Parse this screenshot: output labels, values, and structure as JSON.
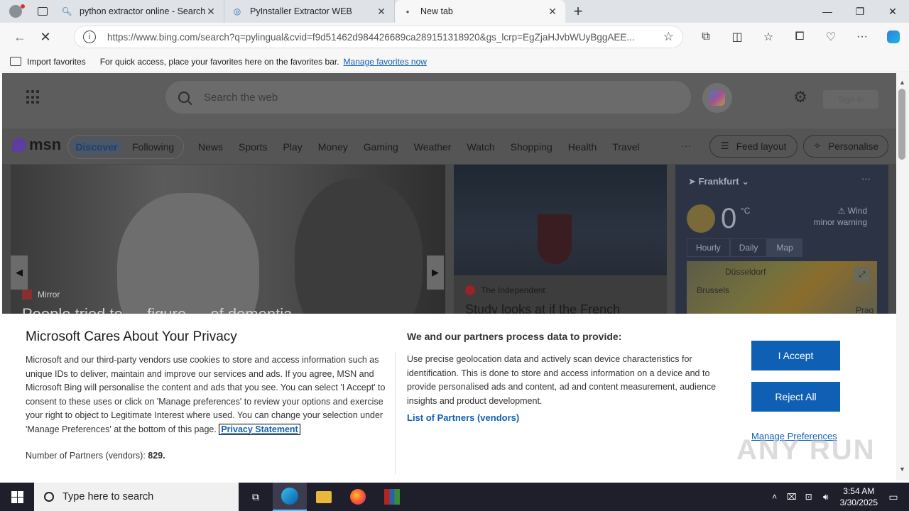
{
  "browser": {
    "tabs": [
      {
        "title": "python extractor online - Search",
        "icon": "search-icon"
      },
      {
        "title": "PyInstaller Extractor WEB",
        "icon": "globe-icon"
      },
      {
        "title": "New tab",
        "icon": "loading-dot-icon"
      }
    ],
    "url": "https://www.bing.com/search?q=pylingual&cvid=f9d51462d984426689ca289151318920&gs_lcrp=EgZjaHJvbWUyBggAEE...",
    "favorites_bar": {
      "import_label": "Import favorites",
      "hint": "For quick access, place your favorites here on the favorites bar.",
      "manage_link": "Manage favorites now"
    }
  },
  "msn": {
    "search_placeholder": "Search the web",
    "signin": "Sign in",
    "logo": "msn",
    "discover": "Discover",
    "following": "Following",
    "categories": [
      "News",
      "Sports",
      "Play",
      "Money",
      "Gaming",
      "Weather",
      "Watch",
      "Shopping",
      "Health",
      "Travel"
    ],
    "more": "···",
    "feed_layout": "Feed layout",
    "personalise": "Personalise",
    "hero": {
      "source": "Mirror",
      "headline": "People tried to … figure … of dementia"
    },
    "card2": {
      "source": "The Independent",
      "title": "Study looks at if the French"
    },
    "weather": {
      "location": "Frankfurt",
      "temp": "0",
      "unit": "°C",
      "warning_title": "Wind",
      "warning_sub": "minor warning",
      "tabs": [
        "Hourly",
        "Daily",
        "Map"
      ],
      "selected_tab": "Map",
      "map_cities": [
        "Düsseldorf",
        "Brussels",
        "Prag"
      ]
    }
  },
  "privacy": {
    "title": "Microsoft Cares About Your Privacy",
    "body": "Microsoft and our third-party vendors use cookies to store and access information such as unique IDs to deliver, maintain and improve our services and ads. If you agree, MSN and Microsoft Bing will personalise the content and ads that you see. You can select 'I Accept' to consent to these uses or click on 'Manage preferences' to review your options and exercise your right to object to Legitimate Interest where used. You can change your selection under 'Manage Preferences' at the bottom of this page.",
    "privacy_link": "Privacy Statement",
    "partners_label": "Number of Partners (vendors):",
    "partners_count": "829.",
    "purpose_title": "We and our partners process data to provide:",
    "purpose_body": "Use precise geolocation data and actively scan device characteristics for identification. This is done to store and access information on a device and to provide personalised ads and content, ad and content measurement, audience insights and product development.",
    "vendors_link": "List of Partners (vendors)",
    "accept": "I Accept",
    "reject": "Reject All",
    "manage": "Manage Preferences"
  },
  "watermark": "ANY RUN",
  "taskbar": {
    "search_placeholder": "Type here to search",
    "time": "3:54 AM",
    "date": "3/30/2025"
  }
}
